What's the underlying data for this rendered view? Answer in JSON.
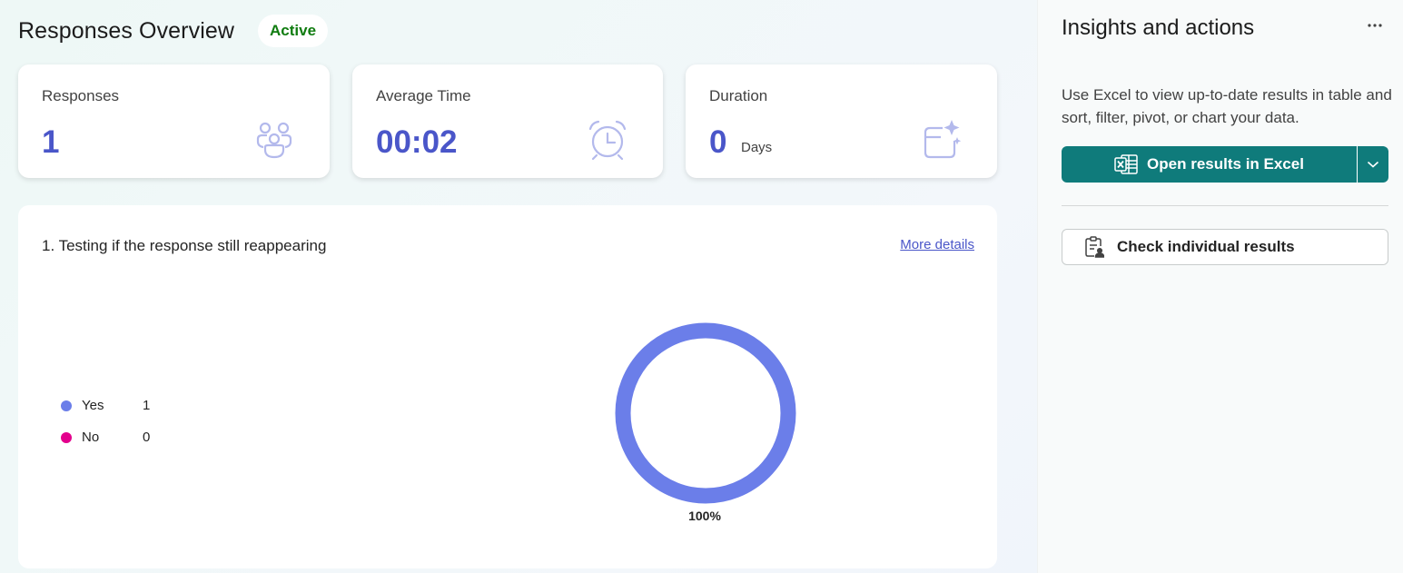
{
  "header": {
    "title": "Responses Overview",
    "status": "Active"
  },
  "stats": [
    {
      "label": "Responses",
      "value": "1",
      "unit": "",
      "icon": "people-icon"
    },
    {
      "label": "Average Time",
      "value": "00:02",
      "unit": "",
      "icon": "alarm-clock-icon"
    },
    {
      "label": "Duration",
      "value": "0",
      "unit": "Days",
      "icon": "calendar-sparkle-icon"
    }
  ],
  "question": {
    "title": "1. Testing if the response still reappearing",
    "more_details": "More details"
  },
  "chart_data": {
    "type": "pie",
    "categories": [
      "Yes",
      "No"
    ],
    "values": [
      1,
      0
    ],
    "colors": [
      "#6b7ee9",
      "#e3008c"
    ],
    "data_labels": [
      "100%"
    ]
  },
  "side": {
    "title": "Insights and actions",
    "description": "Use Excel to view up-to-date results in table and sort, filter, pivot, or chart your data.",
    "excel_button": "Open results in Excel",
    "check_button": "Check individual results"
  }
}
